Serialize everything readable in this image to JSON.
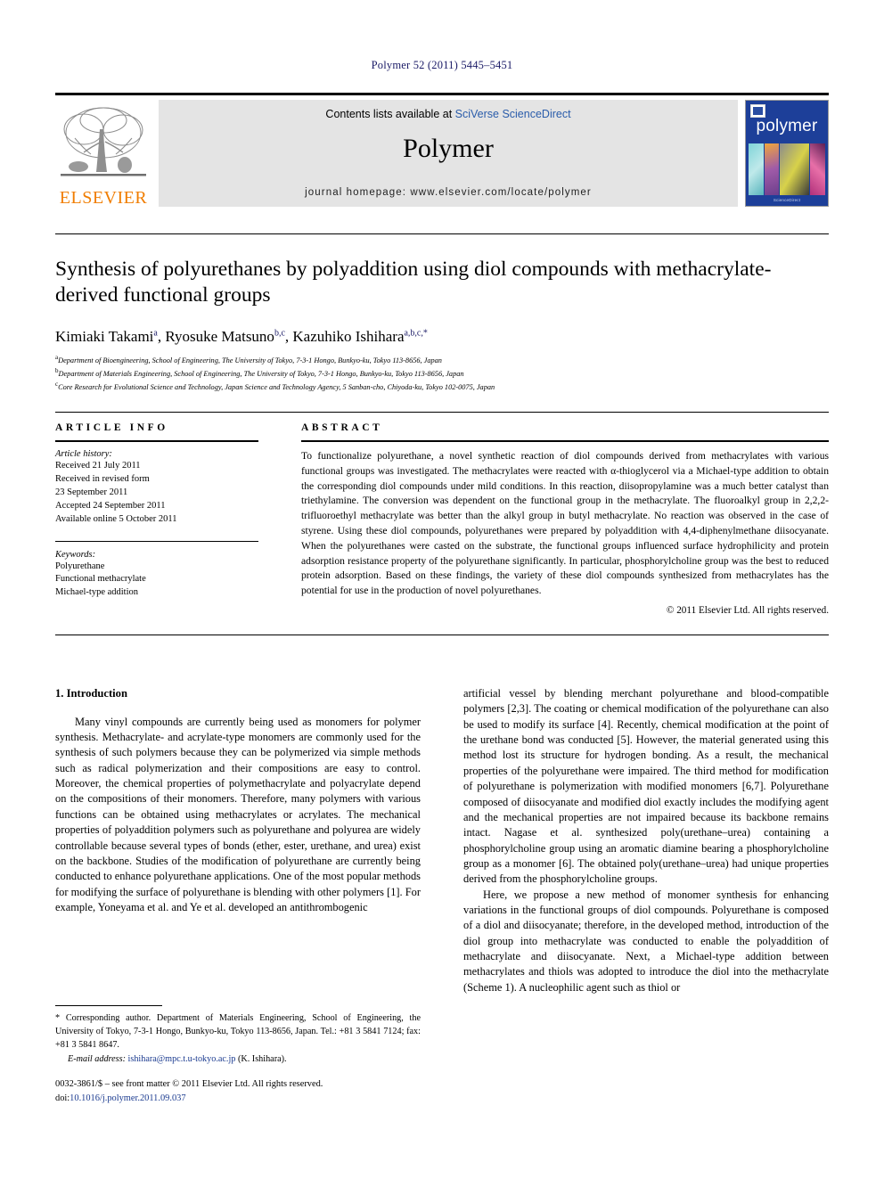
{
  "running_head": "Polymer 52 (2011) 5445–5451",
  "masthead": {
    "publisher": "ELSEVIER",
    "contents_prefix": "Contents lists available at ",
    "contents_link": "SciVerse ScienceDirect",
    "journal_title": "Polymer",
    "homepage": "journal homepage: www.elsevier.com/locate/polymer",
    "cover_word": "polymer",
    "cover_footer": "ScienceDirect"
  },
  "article": {
    "title": "Synthesis of polyurethanes by polyaddition using diol compounds with methacrylate-derived functional groups",
    "authors": [
      {
        "name": "Kimiaki Takami",
        "marks": "a"
      },
      {
        "name": "Ryosuke Matsuno",
        "marks": "b,c"
      },
      {
        "name": "Kazuhiko Ishihara",
        "marks": "a,b,c,*"
      }
    ],
    "affiliations": [
      {
        "mark": "a",
        "text": "Department of Bioengineering, School of Engineering, The University of Tokyo, 7-3-1 Hongo, Bunkyo-ku, Tokyo 113-8656, Japan"
      },
      {
        "mark": "b",
        "text": "Department of Materials Engineering, School of Engineering, The University of Tokyo, 7-3-1 Hongo, Bunkyo-ku, Tokyo 113-8656, Japan"
      },
      {
        "mark": "c",
        "text": "Core Research for Evolutional Science and Technology, Japan Science and Technology Agency, 5 Sanban-cho, Chiyoda-ku, Tokyo 102-0075, Japan"
      }
    ]
  },
  "article_info": {
    "heading": "ARTICLE INFO",
    "history_label": "Article history:",
    "history": [
      "Received 21 July 2011",
      "Received in revised form",
      "23 September 2011",
      "Accepted 24 September 2011",
      "Available online 5 October 2011"
    ],
    "keywords_label": "Keywords:",
    "keywords": [
      "Polyurethane",
      "Functional methacrylate",
      "Michael-type addition"
    ]
  },
  "abstract": {
    "heading": "ABSTRACT",
    "text": "To functionalize polyurethane, a novel synthetic reaction of diol compounds derived from methacrylates with various functional groups was investigated. The methacrylates were reacted with α-thioglycerol via a Michael-type addition to obtain the corresponding diol compounds under mild conditions. In this reaction, diisopropylamine was a much better catalyst than triethylamine. The conversion was dependent on the functional group in the methacrylate. The fluoroalkyl group in 2,2,2-trifluoroethyl methacrylate was better than the alkyl group in butyl methacrylate. No reaction was observed in the case of styrene. Using these diol compounds, polyurethanes were prepared by polyaddition with 4,4-diphenylmethane diisocyanate. When the polyurethanes were casted on the substrate, the functional groups influenced surface hydrophilicity and protein adsorption resistance property of the polyurethane significantly. In particular, phosphorylcholine group was the best to reduced protein adsorption. Based on these findings, the variety of these diol compounds synthesized from methacrylates has the potential for use in the production of novel polyurethanes.",
    "copyright": "© 2011 Elsevier Ltd. All rights reserved."
  },
  "introduction": {
    "section_number": "1.",
    "section_title": "Introduction",
    "left_paragraph": "Many vinyl compounds are currently being used as monomers for polymer synthesis. Methacrylate- and acrylate-type monomers are commonly used for the synthesis of such polymers because they can be polymerized via simple methods such as radical polymerization and their compositions are easy to control. Moreover, the chemical properties of polymethacrylate and polyacrylate depend on the compositions of their monomers. Therefore, many polymers with various functions can be obtained using methacrylates or acrylates. The mechanical properties of polyaddition polymers such as polyurethane and polyurea are widely controllable because several types of bonds (ether, ester, urethane, and urea) exist on the backbone. Studies of the modification of polyurethane are currently being conducted to enhance polyurethane applications. One of the most popular methods for modifying the surface of polyurethane is blending with other polymers [1]. For example, Yoneyama et al. and Ye et al. developed an antithrombogenic",
    "right_paragraph_1": "artificial vessel by blending merchant polyurethane and blood-compatible polymers [2,3]. The coating or chemical modification of the polyurethane can also be used to modify its surface [4]. Recently, chemical modification at the point of the urethane bond was conducted [5]. However, the material generated using this method lost its structure for hydrogen bonding. As a result, the mechanical properties of the polyurethane were impaired. The third method for modification of polyurethane is polymerization with modified monomers [6,7]. Polyurethane composed of diisocyanate and modified diol exactly includes the modifying agent and the mechanical properties are not impaired because its backbone remains intact. Nagase et al. synthesized poly(urethane–urea) containing a phosphorylcholine group using an aromatic diamine bearing a phosphorylcholine group as a monomer [6]. The obtained poly(urethane–urea) had unique properties derived from the phosphorylcholine groups.",
    "right_paragraph_2": "Here, we propose a new method of monomer synthesis for enhancing variations in the functional groups of diol compounds. Polyurethane is composed of a diol and diisocyanate; therefore, in the developed method, introduction of the diol group into methacrylate was conducted to enable the polyaddition of methacrylate and diisocyanate. Next, a Michael-type addition between methacrylates and thiols was adopted to introduce the diol into the methacrylate (Scheme 1). A nucleophilic agent such as thiol or"
  },
  "footnote": {
    "text": "* Corresponding author. Department of Materials Engineering, School of Engineering, the University of Tokyo, 7-3-1 Hongo, Bunkyo-ku, Tokyo 113-8656, Japan. Tel.: +81 3 5841 7124; fax: +81 3 5841 8647.",
    "email_label": "E-mail address:",
    "email": "ishihara@mpc.t.u-tokyo.ac.jp",
    "email_owner": "(K. Ishihara)."
  },
  "page_footer": {
    "issn_line": "0032-3861/$ – see front matter © 2011 Elsevier Ltd. All rights reserved.",
    "doi_label": "doi:",
    "doi": "10.1016/j.polymer.2011.09.037"
  },
  "colors": {
    "link": "#1a3a8f",
    "elsevier_orange": "#f07d00",
    "cover_blue": "#1d3f99",
    "band_gray": "#e4e4e4"
  }
}
